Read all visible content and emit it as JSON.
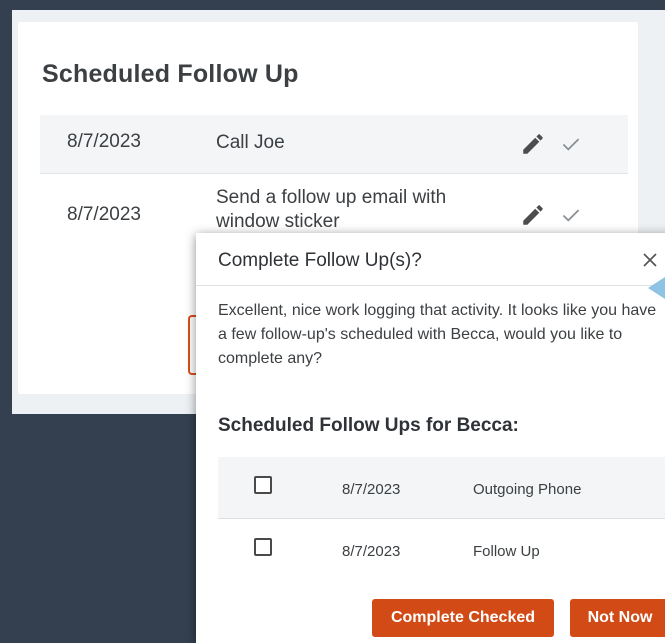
{
  "card": {
    "title": "Scheduled Follow Up",
    "rows": [
      {
        "date": "8/7/2023",
        "description": "Call Joe"
      },
      {
        "date": "8/7/2023",
        "description": "Send a follow up email with window sticker"
      }
    ]
  },
  "modal": {
    "title": "Complete Follow Up(s)?",
    "close_icon": "close-icon",
    "message": "Excellent, nice work logging that activity. It looks like you have a few follow-up's scheduled with Becca, would you like to complete any?",
    "subtitle": "Scheduled Follow Ups for Becca:",
    "rows": [
      {
        "checked": false,
        "date": "8/7/2023",
        "type": "Outgoing Phone"
      },
      {
        "checked": false,
        "date": "8/7/2023",
        "type": "Follow Up"
      }
    ],
    "buttons": {
      "complete": "Complete Checked",
      "not_now": "Not Now"
    }
  },
  "colors": {
    "page_background": "#34404f",
    "accent": "#d24a16",
    "tooltip": "#8fc3e4"
  }
}
